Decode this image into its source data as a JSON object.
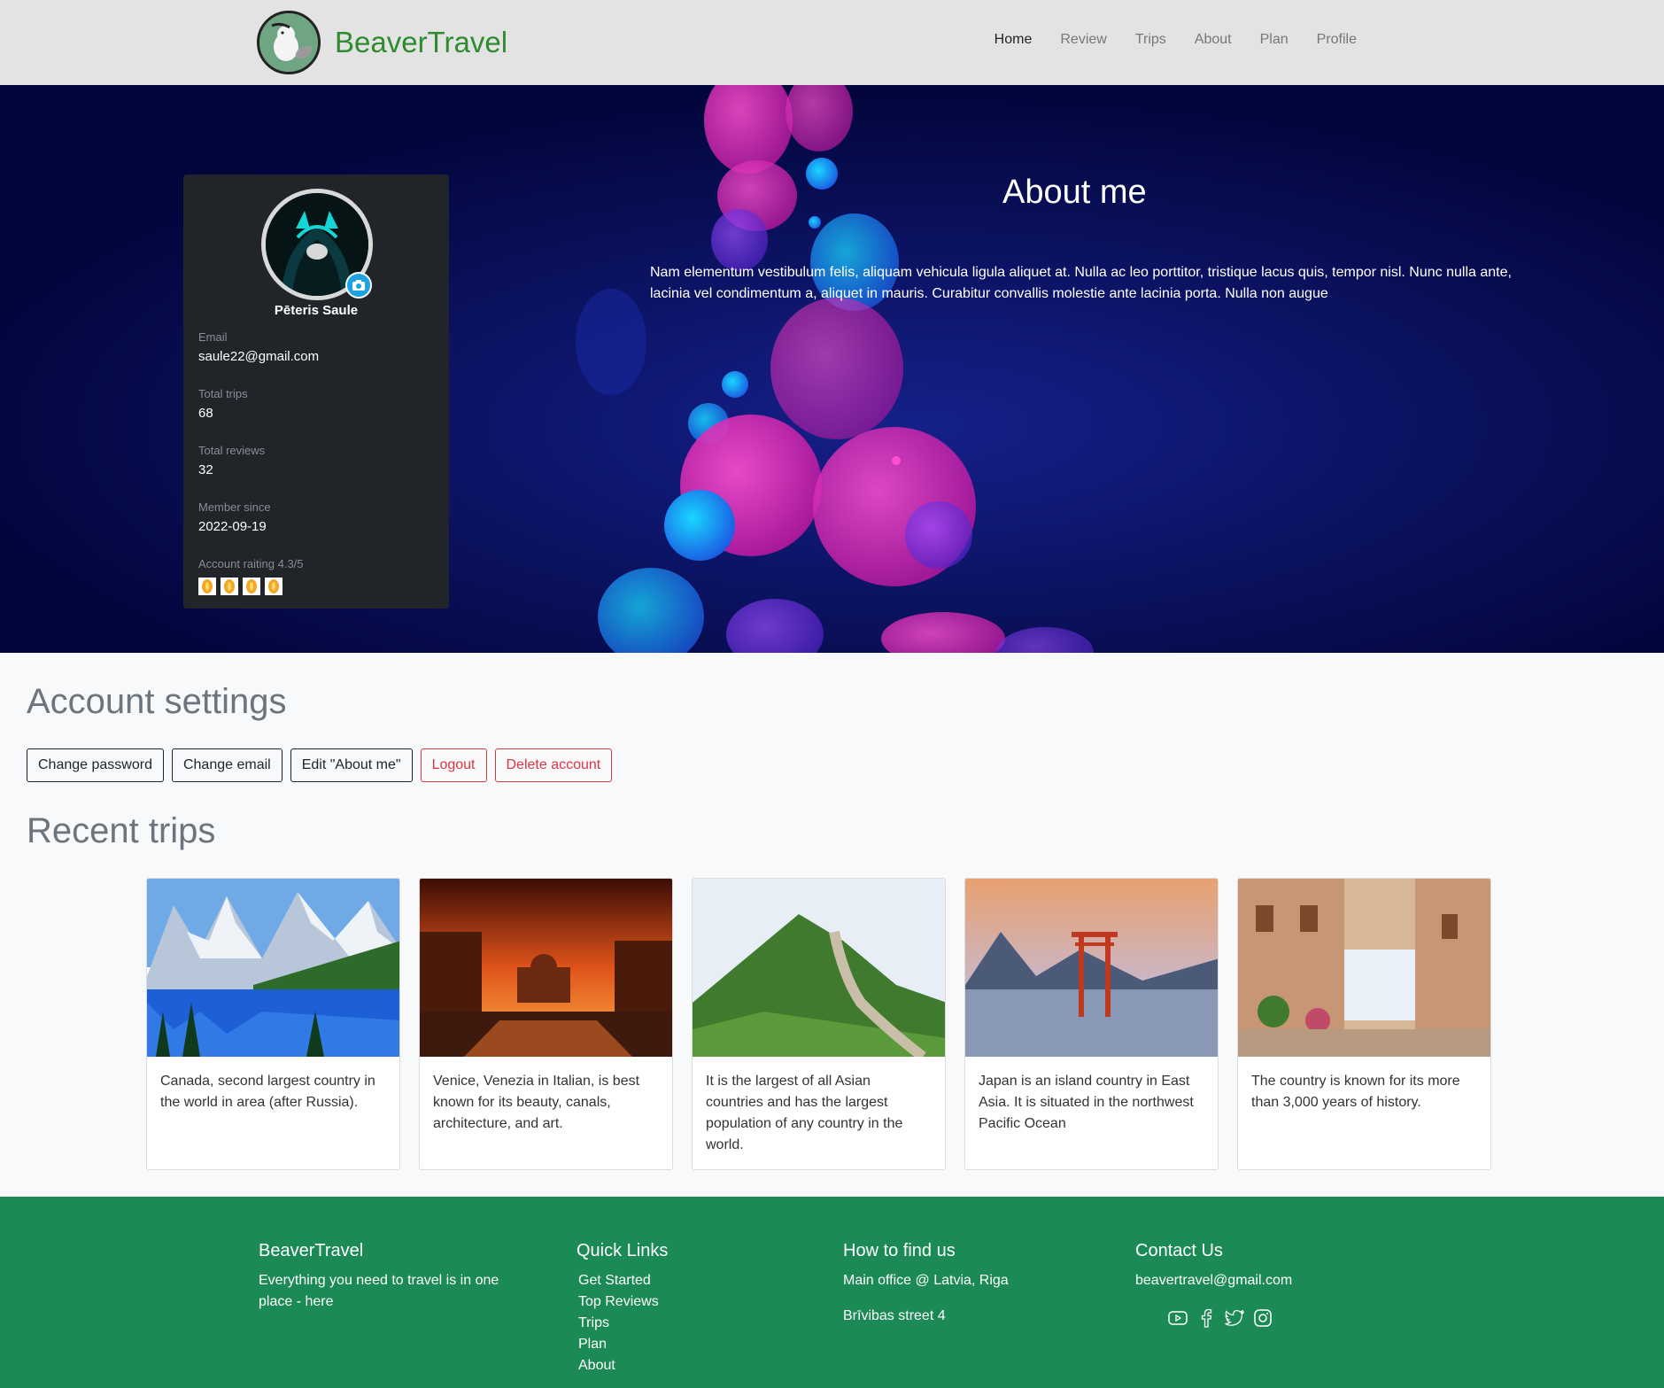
{
  "navbar": {
    "brand": "BeaverTravel",
    "links": [
      "Home",
      "Review",
      "Trips",
      "About",
      "Plan",
      "Profile"
    ]
  },
  "profile": {
    "name": "Pēteris Saule",
    "email_label": "Email",
    "email": "saule22@gmail.com",
    "trips_label": "Total trips",
    "trips": "68",
    "reviews_label": "Total reviews",
    "reviews": "32",
    "member_label": "Member since",
    "member_since": "2022-09-19",
    "rating_label": "Account raiting 4.3/5",
    "rating_stars_shown": 4
  },
  "about": {
    "title": "About me",
    "text": "Nam elementum vestibulum felis, aliquam vehicula ligula aliquet at. Nulla ac leo porttitor, tristique lacus quis, tempor nisl. Nunc nulla ante, lacinia vel condimentum a, aliquet in mauris. Curabitur convallis molestie ante lacinia porta. Nulla non augue"
  },
  "settings": {
    "title": "Account settings",
    "buttons": [
      "Change password",
      "Change email",
      "Edit \"About me\"",
      "Logout",
      "Delete account"
    ]
  },
  "trips": {
    "title": "Recent trips",
    "cards": [
      {
        "text": "Canada, second largest country in the world in area (after Russia)."
      },
      {
        "text": "Venice, Venezia in Italian, is best known for its beauty, canals, architecture, and art."
      },
      {
        "text": "It is the largest of all Asian countries and has the largest population of any country in the world."
      },
      {
        "text": "Japan is an island country in East Asia. It is situated in the northwest Pacific Ocean"
      },
      {
        "text": "The country is known for its more than 3,000 years of history."
      }
    ]
  },
  "footer": {
    "brand_title": "BeaverTravel",
    "brand_text": "Everything you need to travel is in one place - here",
    "links_title": "Quick Links",
    "links": [
      "Get Started",
      "Top Reviews",
      "Trips",
      "Plan",
      "About"
    ],
    "find_title": "How to find us",
    "find_line1": "Main office @ Latvia, Riga",
    "find_line2": "Brīvibas street 4",
    "contact_title": "Contact Us",
    "contact_email": "beavertravel@gmail.com",
    "social_icons": [
      "youtube-icon",
      "facebook-icon",
      "twitter-icon",
      "instagram-icon"
    ]
  },
  "colors": {
    "brand_green": "#2e8b2e",
    "footer_bg": "#1b8a55",
    "hero_bg": "#03063d",
    "danger": "#dc3545",
    "star": "#f5a623"
  }
}
